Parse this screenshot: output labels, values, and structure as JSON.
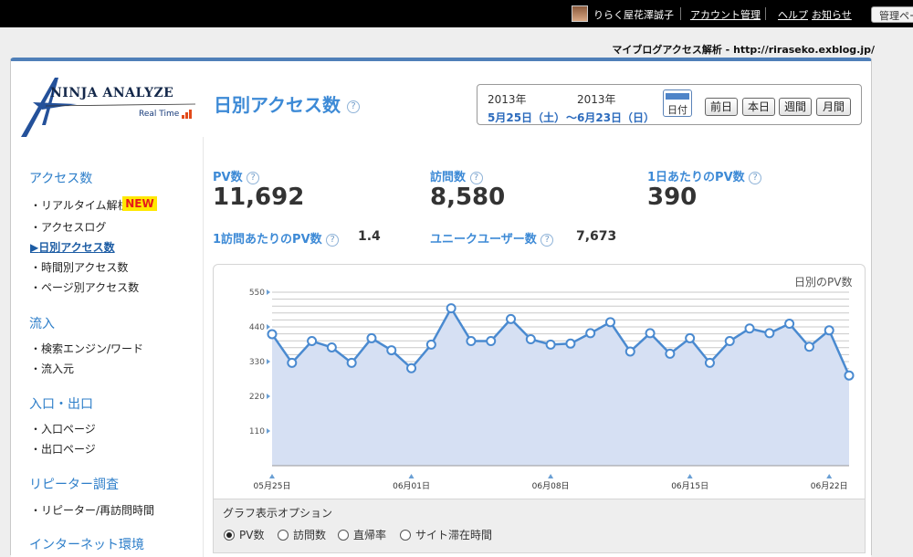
{
  "topbar": {
    "username": "りらく屋花澤誠子",
    "links": [
      "アカウント管理",
      "ヘルプ",
      "お知らせ"
    ],
    "admin_button": "管理ページ"
  },
  "blog_line": "マイブログアクセス解析 - http://riraseko.exblog.jp/",
  "logo": {
    "name": "NINJA ANALYZE",
    "tagline": "Real Time"
  },
  "page_title": "日別アクセス数",
  "help_glyph": "?",
  "date_range": {
    "from_year": "2013年",
    "from_date": "5月25日（土）",
    "to_year": "2013年",
    "to_date": "〜6月23日（日）",
    "calendar_label": "日付",
    "buttons": [
      "前日",
      "本日",
      "週間",
      "月間"
    ]
  },
  "sidebar": {
    "sections": [
      {
        "title": "アクセス数",
        "items": [
          "リアルタイム解析",
          "アクセスログ",
          "日別アクセス数",
          "時間別アクセス数",
          "ページ別アクセス数"
        ]
      },
      {
        "title": "流入",
        "items": [
          "検索エンジン/ワード",
          "流入元"
        ]
      },
      {
        "title": "入口・出口",
        "items": [
          "入口ページ",
          "出口ページ"
        ]
      },
      {
        "title": "リピーター調査",
        "items": [
          "リピーター/再訪問時間"
        ]
      },
      {
        "title": "インターネット環境",
        "items": []
      }
    ],
    "new_badge": "NEW",
    "active_item": "日別アクセス数"
  },
  "stats": {
    "pv_label": "PV数",
    "pv_value": "11,692",
    "visits_label": "訪問数",
    "visits_value": "8,580",
    "daily_pv_label": "1日あたりのPV数",
    "daily_pv_value": "390",
    "pv_per_visit_label": "1訪問あたりのPV数",
    "pv_per_visit_value": "1.4",
    "unique_label": "ユニークユーザー数",
    "unique_value": "7,673"
  },
  "chart_data": {
    "type": "area",
    "title": "日別のPV数",
    "xlabel": "",
    "ylabel": "",
    "ylim": [
      0,
      550
    ],
    "yticks": [
      110,
      220,
      330,
      440,
      550
    ],
    "xtick_labels": [
      "05月25日",
      "06月01日",
      "06月08日",
      "06月15日",
      "06月22日"
    ],
    "xtick_indices": [
      0,
      7,
      14,
      21,
      28
    ],
    "x": [
      "05/25",
      "05/26",
      "05/27",
      "05/28",
      "05/29",
      "05/30",
      "05/31",
      "06/01",
      "06/02",
      "06/03",
      "06/04",
      "06/05",
      "06/06",
      "06/07",
      "06/08",
      "06/09",
      "06/10",
      "06/11",
      "06/12",
      "06/13",
      "06/14",
      "06/15",
      "06/16",
      "06/17",
      "06/18",
      "06/19",
      "06/20",
      "06/21",
      "06/22",
      "06/23"
    ],
    "series": [
      {
        "values": [
          417,
          326,
          395,
          375,
          326,
          404,
          366,
          309,
          384,
          499,
          395,
          395,
          465,
          401,
          384,
          387,
          420,
          455,
          362,
          420,
          355,
          404,
          326,
          395,
          435,
          420,
          450,
          377,
          429,
          286
        ]
      }
    ],
    "grid": true,
    "fill_color": "#d6e0f3",
    "line_color": "#4a8ad0"
  },
  "graph_options": {
    "title": "グラフ表示オプション",
    "options": [
      "PV数",
      "訪問数",
      "直帰率",
      "サイト滞在時間"
    ],
    "selected": "PV数"
  }
}
